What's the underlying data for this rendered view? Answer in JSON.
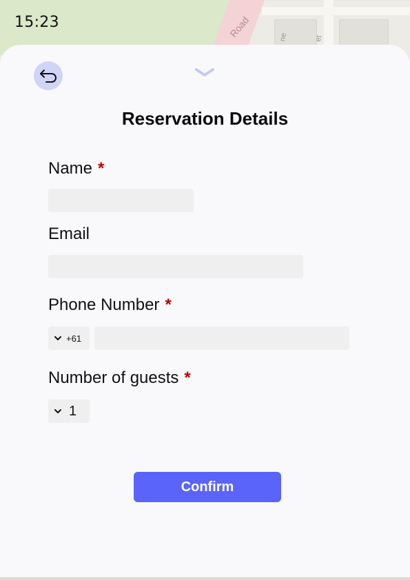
{
  "status_bar": {
    "time": "15:23"
  },
  "map": {
    "road_label": "Road",
    "street_label_1": "ne",
    "street_label_2": "et"
  },
  "sheet": {
    "title": "Reservation Details",
    "back_icon": "return-arrow-icon",
    "handle_icon": "chevron-down-icon"
  },
  "form": {
    "name": {
      "label": "Name",
      "required_mark": "*",
      "value": "",
      "placeholder": ""
    },
    "email": {
      "label": "Email",
      "value": "",
      "placeholder": ""
    },
    "phone": {
      "label": "Phone Number",
      "required_mark": "*",
      "country_code": "+61",
      "value": "",
      "placeholder": ""
    },
    "guests": {
      "label": "Number of guests",
      "required_mark": "*",
      "value": "1"
    }
  },
  "confirm_label": "Confirm",
  "colors": {
    "accent": "#5a64fb",
    "back_button_bg": "#d0d4f6",
    "required": "#c00000",
    "input_bg": "#efefef",
    "sheet_bg": "#f9f9fc"
  }
}
